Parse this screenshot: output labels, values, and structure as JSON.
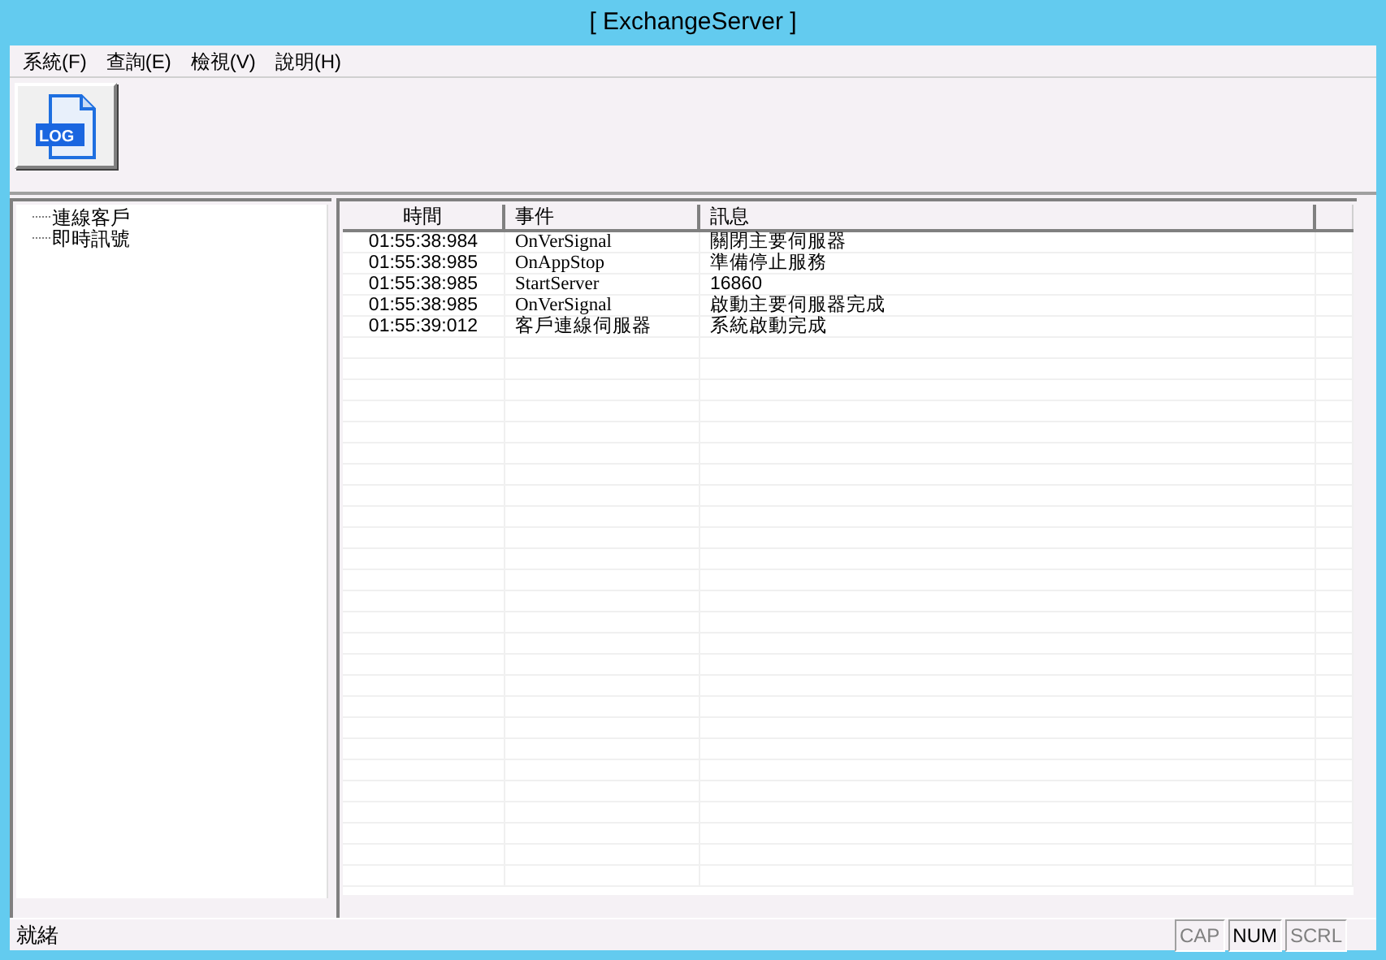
{
  "window": {
    "title": "[ ExchangeServer ]"
  },
  "menu": [
    "系統(F)",
    "查詢(E)",
    "檢視(V)",
    "說明(H)"
  ],
  "toolbar": [
    {
      "label": "LOG"
    }
  ],
  "tree": {
    "items": [
      {
        "label": "連線客戶"
      },
      {
        "label": "即時訊號"
      }
    ]
  },
  "table": {
    "columns": [
      "時間",
      "事件",
      "訊息"
    ],
    "rows": [
      [
        "01:55:38:984",
        "OnVerSignal",
        "關閉主要伺服器"
      ],
      [
        "01:55:38:985",
        "OnAppStop",
        "準備停止服務"
      ],
      [
        "01:55:38:985",
        "StartServer",
        "16860"
      ],
      [
        "01:55:38:985",
        "OnVerSignal",
        "啟動主要伺服器完成"
      ],
      [
        "01:55:39:012",
        "客戶連線伺服器",
        "系統啟動完成"
      ]
    ]
  },
  "status_bar": {
    "text": "就緒",
    "indicators": [
      {
        "label": "CAP",
        "on": false
      },
      {
        "label": "NUM",
        "on": true
      },
      {
        "label": "SCRL",
        "on": false
      }
    ]
  }
}
